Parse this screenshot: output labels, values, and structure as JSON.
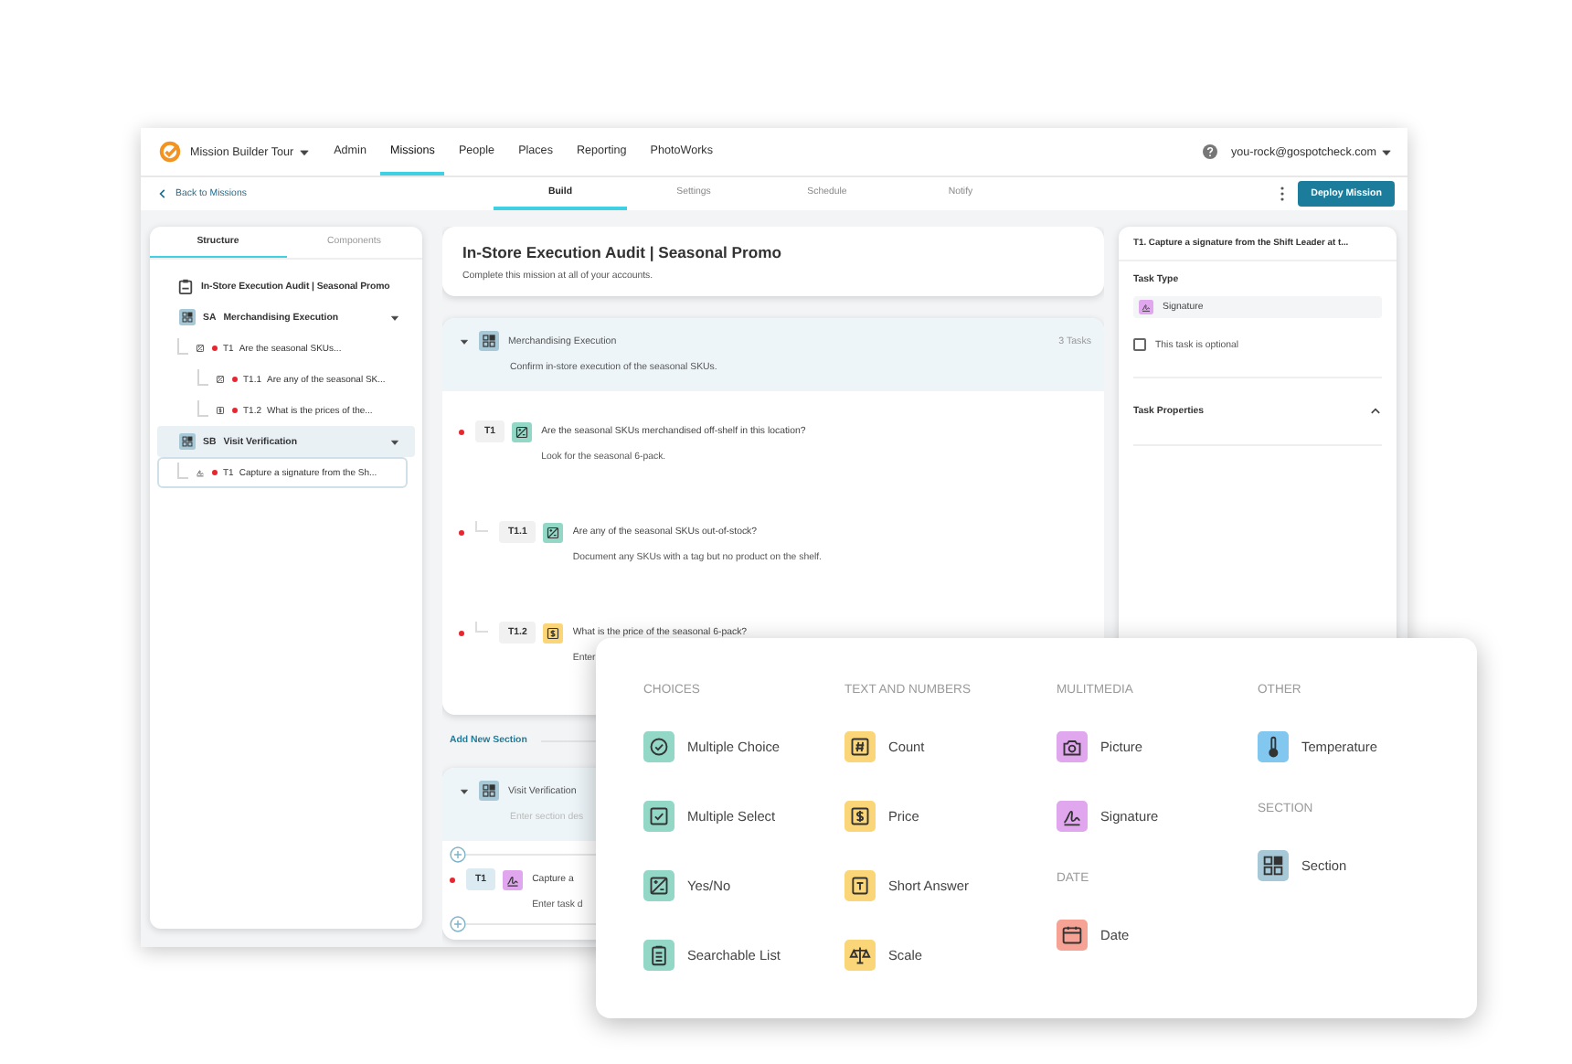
{
  "nav": {
    "org": "Mission Builder Tour",
    "menu": [
      {
        "label": "Admin",
        "selected": false
      },
      {
        "label": "Missions",
        "selected": true
      },
      {
        "label": "People",
        "selected": false
      },
      {
        "label": "Places",
        "selected": false
      },
      {
        "label": "Reporting",
        "selected": false
      },
      {
        "label": "PhotoWorks",
        "selected": false
      }
    ],
    "user": "you-rock@gospotcheck.com"
  },
  "subnav": {
    "back": "Back to Missions",
    "tabs": [
      {
        "label": "Build",
        "selected": true
      },
      {
        "label": "Settings",
        "selected": false
      },
      {
        "label": "Schedule",
        "selected": false
      },
      {
        "label": "Notify",
        "selected": false
      }
    ],
    "action": "Deploy Mission"
  },
  "structure": {
    "tabs": [
      {
        "label": "Structure",
        "selected": true
      },
      {
        "label": "Components",
        "selected": false
      }
    ],
    "mission": "In-Store Execution Audit | Seasonal Promo",
    "sections": [
      {
        "code": "SA",
        "title": "Merchandising Execution",
        "expanded": true,
        "selected": false,
        "tasks": [
          {
            "code": "T1",
            "text": "Are the seasonal SKUs...",
            "kind": "yesno",
            "required": true,
            "selected": false,
            "children": [
              {
                "code": "T1.1",
                "text": "Are any of the seasonal SK...",
                "kind": "yesno",
                "required": true,
                "selected": false
              },
              {
                "code": "T1.2",
                "text": "What is the prices of the...",
                "kind": "price",
                "required": true,
                "selected": false
              }
            ]
          }
        ]
      },
      {
        "code": "SB",
        "title": "Visit Verification",
        "expanded": true,
        "selected": true,
        "tasks": [
          {
            "code": "T1",
            "text": "Capture a signature from the Sh...",
            "kind": "signature",
            "required": true,
            "selected": true
          }
        ]
      }
    ]
  },
  "editor": {
    "title": "In-Store Execution Audit | Seasonal Promo",
    "description": "Complete this mission at all of your accounts.",
    "sections": [
      {
        "title": "Merchandising Execution",
        "expanded": true,
        "count": "3 Tasks",
        "description": "Confirm in-store execution of the seasonal SKUs.",
        "tasks": [
          {
            "code": "T1",
            "kind": "yesno",
            "required": true,
            "selected": false,
            "question": "Are the seasonal SKUs merchandised off-shelf in this location?",
            "description": "Look for the seasonal 6-pack.",
            "children": [
              {
                "code": "T1.1",
                "kind": "yesno",
                "required": true,
                "selected": false,
                "question": "Are any of the seasonal SKUs out-of-stock?",
                "description": "Document any SKUs with a tag but no product on the shelf."
              },
              {
                "code": "T1.2",
                "kind": "price",
                "required": true,
                "selected": false,
                "question": "What is the price  of the seasonal 6-pack?",
                "description": "Enter"
              }
            ]
          }
        ]
      },
      {
        "title": "Visit Verification",
        "expanded": true,
        "placeholder": "Enter section des",
        "tasks": [
          {
            "code": "T1",
            "kind": "signature",
            "required": true,
            "selected": true,
            "question": "Capture a",
            "placeholder": "Enter task d"
          }
        ]
      }
    ],
    "add_section": "Add New Section"
  },
  "task_panel": {
    "title": "T1. Capture a signature from the Shift Leader at t...",
    "type_label": "Task Type",
    "type": {
      "kind": "signature",
      "label": "Signature"
    },
    "optional": {
      "label": "This task is optional",
      "checked": false
    },
    "properties": {
      "label": "Task Properties",
      "expanded": true
    }
  },
  "picker": {
    "columns": [
      {
        "groups": [
          {
            "heading": "CHOICES",
            "items": [
              {
                "label": "Multiple Choice",
                "kind": "multiple_choice"
              },
              {
                "label": "Multiple Select",
                "kind": "multiple_select"
              },
              {
                "label": "Yes/No",
                "kind": "yesno"
              },
              {
                "label": "Searchable List",
                "kind": "searchable_list"
              }
            ]
          }
        ]
      },
      {
        "groups": [
          {
            "heading": "TEXT AND NUMBERS",
            "items": [
              {
                "label": "Count",
                "kind": "count"
              },
              {
                "label": "Price",
                "kind": "price"
              },
              {
                "label": "Short Answer",
                "kind": "short_answer"
              },
              {
                "label": "Scale",
                "kind": "scale"
              }
            ]
          }
        ]
      },
      {
        "groups": [
          {
            "heading": "MULITMEDIA",
            "items": [
              {
                "label": "Picture",
                "kind": "picture"
              },
              {
                "label": "Signature",
                "kind": "signature"
              }
            ]
          },
          {
            "heading": "DATE",
            "items": [
              {
                "label": "Date",
                "kind": "date"
              }
            ]
          }
        ]
      },
      {
        "groups": [
          {
            "heading": "OTHER",
            "items": [
              {
                "label": "Temperature",
                "kind": "temperature"
              }
            ]
          },
          {
            "heading": "SECTION",
            "items": [
              {
                "label": "Section",
                "kind": "section"
              }
            ]
          }
        ]
      }
    ]
  }
}
